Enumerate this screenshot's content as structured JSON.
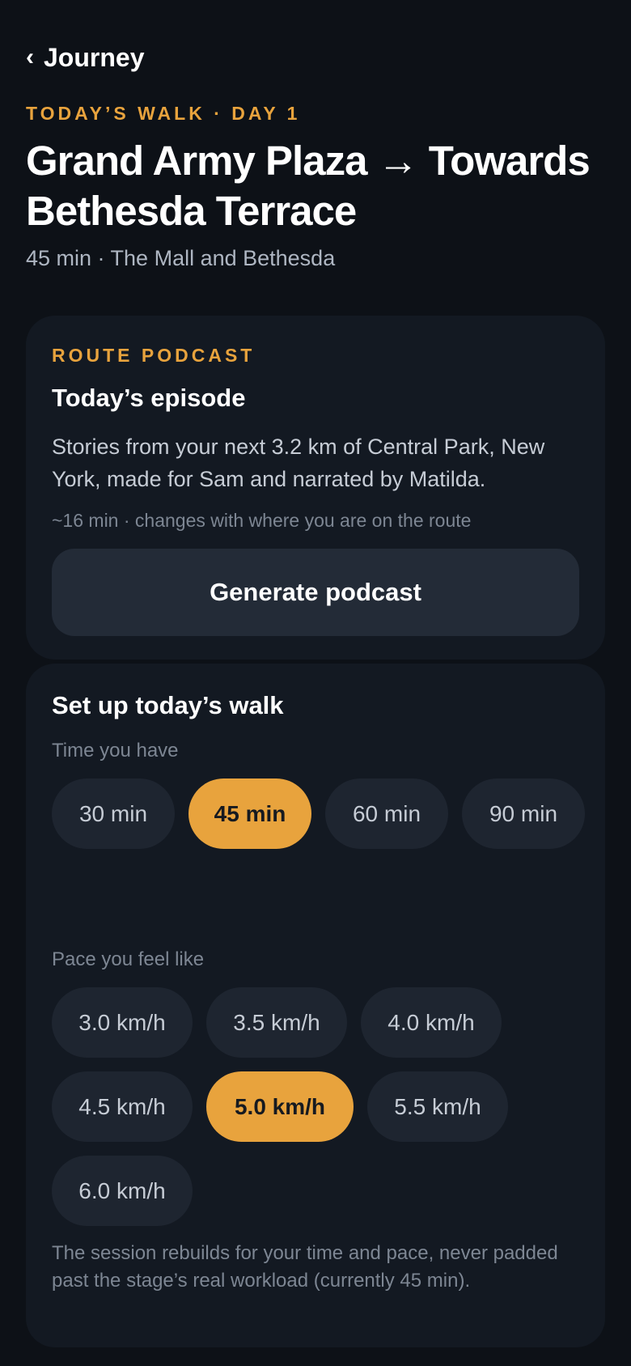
{
  "nav": {
    "back_label": "Journey"
  },
  "header": {
    "eyebrow": "TODAY’S WALK · DAY 1",
    "title": "Grand Army Plaza → Towards Bethesda Terrace",
    "subtitle": "45 min · The Mall and Bethesda"
  },
  "podcast": {
    "eyebrow": "ROUTE PODCAST",
    "heading": "Today’s episode",
    "description": "Stories from your next 3.2 km of Central Park, New York, made for Sam and narrated by Matilda.",
    "meta": "~16 min · changes with where you are on the route",
    "button_label": "Generate podcast"
  },
  "setup": {
    "heading": "Set up today’s walk",
    "time_label": "Time you have",
    "time_options": [
      "30 min",
      "45 min",
      "60 min",
      "90 min"
    ],
    "time_selected": "45 min",
    "pace_label": "Pace you feel like",
    "pace_options": [
      "3.0 km/h",
      "3.5 km/h",
      "4.0 km/h",
      "4.5 km/h",
      "5.0 km/h",
      "5.5 km/h",
      "6.0 km/h"
    ],
    "pace_selected": "5.0 km/h",
    "note": "The session rebuilds for your time and pace, never padded past the stage’s real workload (currently 45 min)."
  },
  "colors": {
    "background": "#0d1117",
    "card": "#131922",
    "accent": "#e8a33d",
    "chip": "#1e2530",
    "button": "#232b37"
  }
}
